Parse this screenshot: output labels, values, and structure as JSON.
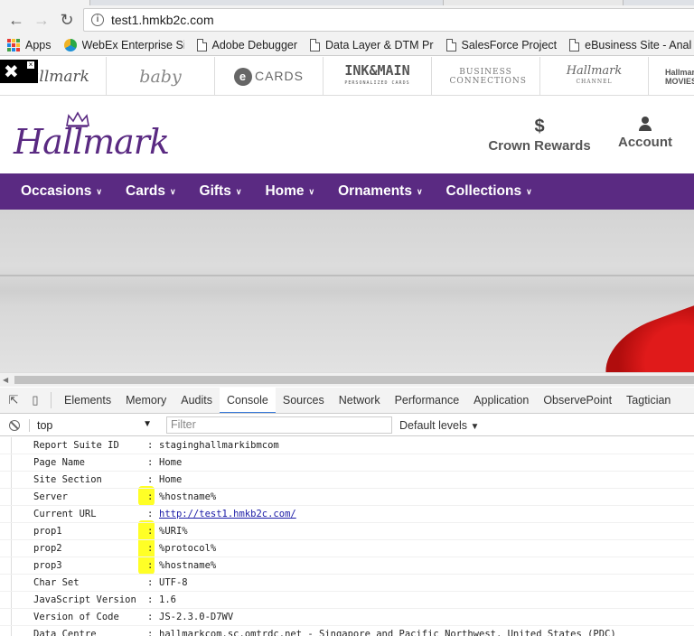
{
  "browser": {
    "url": "test1.hmkb2c.com",
    "bookmarks": [
      {
        "label": "Apps",
        "icon": "apps-grid-icon"
      },
      {
        "label": "WebEx Enterprise Site",
        "icon": "webex-icon"
      },
      {
        "label": "Adobe Debugger",
        "icon": "page-icon"
      },
      {
        "label": "Data Layer & DTM Pr",
        "icon": "page-icon"
      },
      {
        "label": "SalesForce Project",
        "icon": "page-icon"
      },
      {
        "label": "eBusiness Site - Anal",
        "icon": "page-icon"
      }
    ]
  },
  "brand_strip": {
    "items": [
      "Hallmark",
      "baby",
      "CARDS",
      "INK&MAIN",
      "BUSINESS CONNECTIONS",
      "Hallmark",
      "Hallmark MOVIES"
    ],
    "ink_sub": "PERSONALIZED CARDS",
    "channel_sub": "CHANNEL"
  },
  "header": {
    "logo": "Hallmark",
    "rewards_glyph": "$",
    "rewards_label": "Crown Rewards",
    "account_label": "Account"
  },
  "nav": {
    "items": [
      "Occasions",
      "Cards",
      "Gifts",
      "Home",
      "Ornaments",
      "Collections"
    ]
  },
  "devtools": {
    "tabs": [
      "Elements",
      "Memory",
      "Audits",
      "Console",
      "Sources",
      "Network",
      "Performance",
      "Application",
      "ObservePoint",
      "Tagtician"
    ],
    "active_tab": "Console",
    "context": "top",
    "filter_placeholder": "Filter",
    "levels": "Default levels"
  },
  "console": {
    "rows": [
      {
        "key": "Report Suite ID",
        "value": "staginghallmarkibmcom"
      },
      {
        "key": "Page Name",
        "value": "Home"
      },
      {
        "key": "Site Section",
        "value": "Home"
      },
      {
        "key": "Server",
        "value": "%hostname%"
      },
      {
        "key": "Current URL",
        "value": "http://test1.hmkb2c.com/"
      },
      {
        "key": "prop1",
        "value": "%URI%"
      },
      {
        "key": "prop2",
        "value": "%protocol%"
      },
      {
        "key": "prop3",
        "value": "%hostname%"
      },
      {
        "key": "Char Set",
        "value": "UTF-8"
      },
      {
        "key": "JavaScript Version",
        "value": "1.6"
      },
      {
        "key": "Version of Code",
        "value": "JS-2.3.0-D7WV"
      },
      {
        "key": "Data Centre",
        "value": "hallmarkcom.sc.omtrdc.net - Singapore and Pacific Northwest, United States (PDC)"
      }
    ],
    "separator": ":"
  },
  "colors": {
    "brand_purple": "#5a2a82",
    "highlight": "#ffff00",
    "active_tab_underline": "#3879d9"
  }
}
